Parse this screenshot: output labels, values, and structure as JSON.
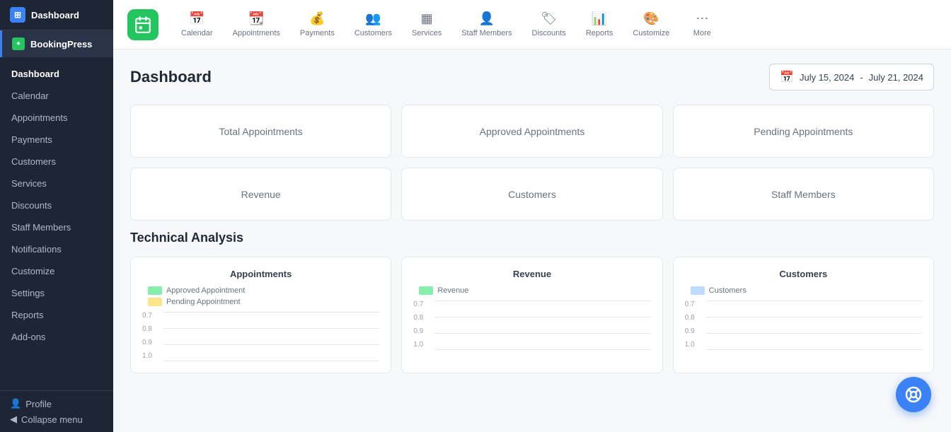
{
  "sidebar": {
    "app_name": "Dashboard",
    "brand_icon": "W",
    "brand_name": "BookingPress",
    "nav_items": [
      {
        "label": "Dashboard",
        "active": true
      },
      {
        "label": "Calendar",
        "active": false
      },
      {
        "label": "Appointments",
        "active": false
      },
      {
        "label": "Payments",
        "active": false
      },
      {
        "label": "Customers",
        "active": false
      },
      {
        "label": "Services",
        "active": false
      },
      {
        "label": "Discounts",
        "active": false
      },
      {
        "label": "Staff Members",
        "active": false
      },
      {
        "label": "Notifications",
        "active": false
      },
      {
        "label": "Customize",
        "active": false
      },
      {
        "label": "Settings",
        "active": false
      },
      {
        "label": "Reports",
        "active": false
      },
      {
        "label": "Add-ons",
        "active": false
      }
    ],
    "profile_label": "Profile",
    "collapse_label": "Collapse menu"
  },
  "topnav": {
    "items": [
      {
        "label": "Calendar",
        "icon": "📅"
      },
      {
        "label": "Appointments",
        "icon": "📆"
      },
      {
        "label": "Payments",
        "icon": "💰"
      },
      {
        "label": "Customers",
        "icon": "👥"
      },
      {
        "label": "Services",
        "icon": "▦"
      },
      {
        "label": "Staff Members",
        "icon": "👤"
      },
      {
        "label": "Discounts",
        "icon": "🏷"
      },
      {
        "label": "Reports",
        "icon": "📊"
      },
      {
        "label": "Customize",
        "icon": "🎨"
      },
      {
        "label": "More",
        "icon": "⋯"
      }
    ]
  },
  "dashboard": {
    "title": "Dashboard",
    "date_from": "July 15, 2024",
    "date_separator": "-",
    "date_to": "July 21, 2024",
    "stat_cards": [
      {
        "label": "Total Appointments"
      },
      {
        "label": "Approved Appointments"
      },
      {
        "label": "Pending Appointments"
      },
      {
        "label": "Revenue"
      },
      {
        "label": "Customers"
      },
      {
        "label": "Staff Members"
      }
    ],
    "technical_analysis_title": "Technical Analysis",
    "charts": [
      {
        "title": "Appointments",
        "legend": [
          {
            "label": "Approved Appointment",
            "color": "#86efac"
          },
          {
            "label": "Pending Appointment",
            "color": "#fde68a"
          }
        ],
        "y_axis": [
          "1.0",
          "0.9",
          "0.8",
          "0.7"
        ]
      },
      {
        "title": "Revenue",
        "legend": [
          {
            "label": "Revenue",
            "color": "#86efac"
          }
        ],
        "y_axis": [
          "1.0",
          "0.9",
          "0.8",
          "0.7"
        ]
      },
      {
        "title": "Customers",
        "legend": [
          {
            "label": "Customers",
            "color": "#bfdbfe"
          }
        ],
        "y_axis": [
          "1.0",
          "0.9",
          "0.8",
          "0.7"
        ]
      }
    ]
  },
  "fab": {
    "icon": "⊙",
    "label": "Help"
  },
  "colors": {
    "sidebar_bg": "#1e2535",
    "brand_green": "#22c55e",
    "accent_blue": "#3b82f6"
  }
}
